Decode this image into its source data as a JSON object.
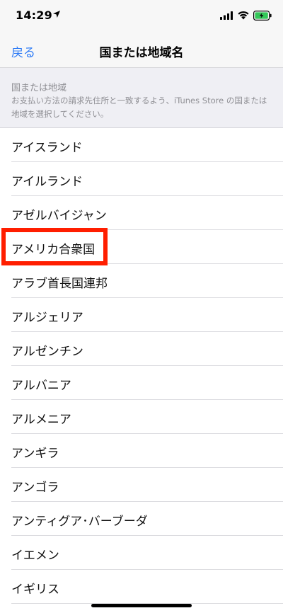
{
  "status_bar": {
    "time": "14:29"
  },
  "nav": {
    "back_label": "戻る",
    "title": "国または地域名"
  },
  "section": {
    "title": "国または地域",
    "description": "お支払い方法の請求先住所と一致するよう、iTunes Store の国または地域を選択してください。"
  },
  "countries": [
    "アイスランド",
    "アイルランド",
    "アゼルバイジャン",
    "アメリカ合衆国",
    "アラブ首長国連邦",
    "アルジェリア",
    "アルゼンチン",
    "アルバニア",
    "アルメニア",
    "アンギラ",
    "アンゴラ",
    "アンティグア･バーブーダ",
    "イエメン",
    "イギリス"
  ],
  "highlighted_item": "アメリカ合衆国",
  "colors": {
    "accent": "#2f7cf6",
    "highlight": "#ff1e00",
    "battery": "#34c759"
  }
}
